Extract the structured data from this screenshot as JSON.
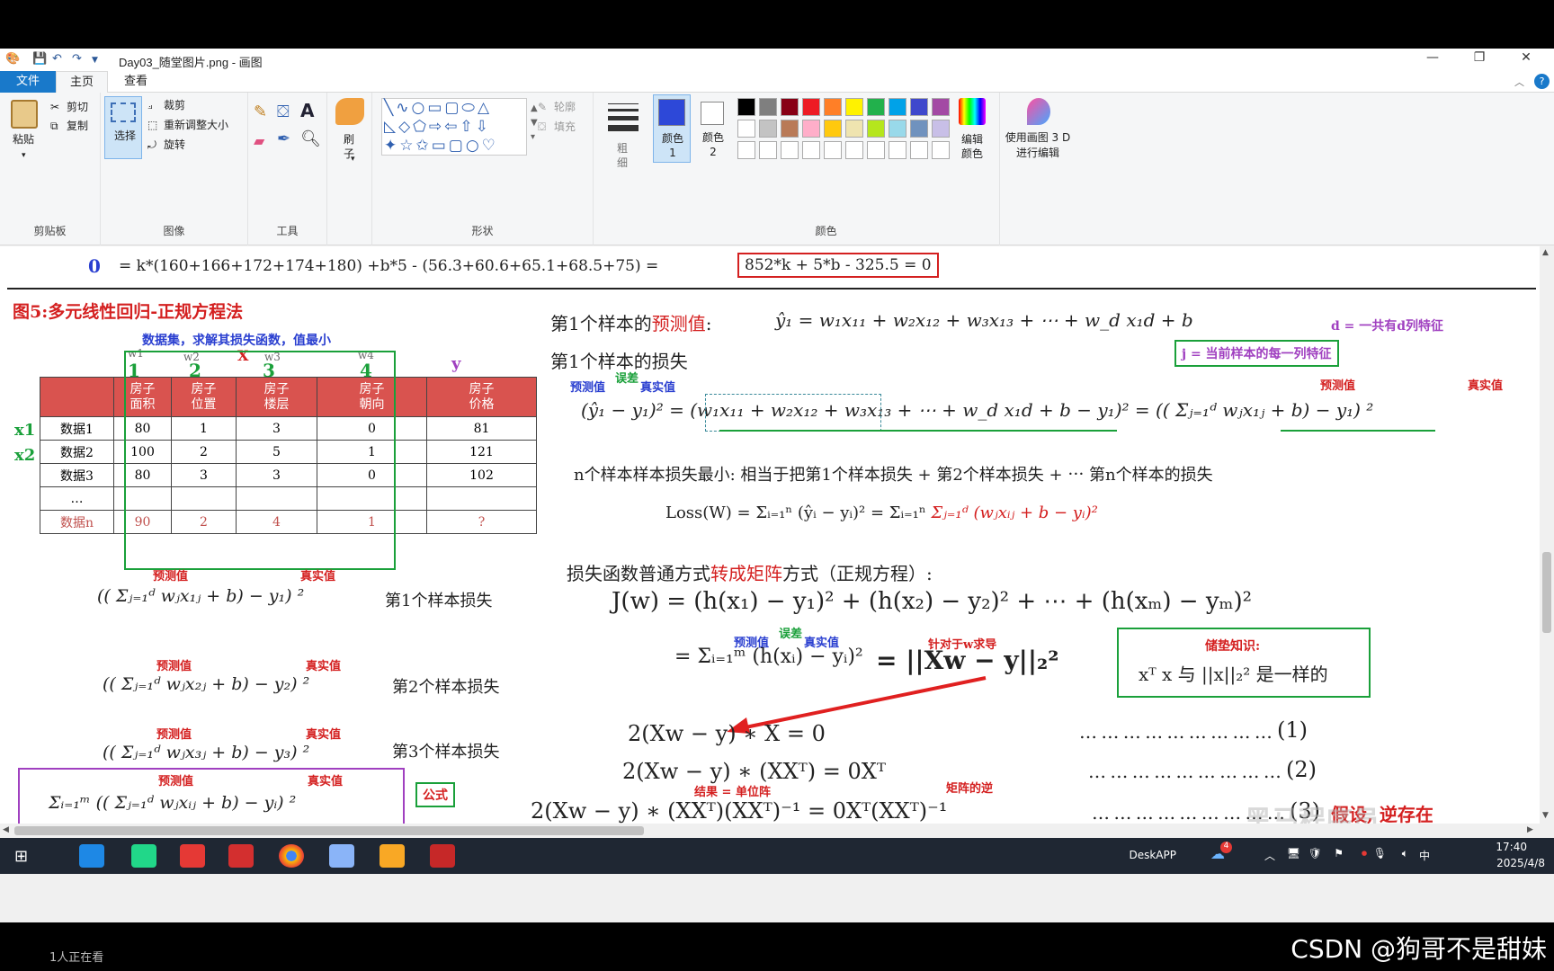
{
  "window": {
    "title": "Day03_随堂图片.png - 画图",
    "minimize": "—",
    "restore": "❐",
    "close": "✕",
    "help": "?"
  },
  "menu": {
    "file": "文件",
    "home": "主页",
    "view": "查看"
  },
  "ribbon": {
    "clipboard": {
      "paste": "粘贴",
      "cut": "剪切",
      "copy": "复制",
      "label": "剪贴板"
    },
    "image": {
      "select": "选择",
      "crop": "裁剪",
      "resize": "重新调整大小",
      "rotate": "旋转",
      "label": "图像"
    },
    "tools": {
      "label": "工具"
    },
    "brush": {
      "label": "刷子"
    },
    "shapes": {
      "outline": "轮廓",
      "fill": "填充",
      "label": "形状"
    },
    "size": {
      "label": "粗细"
    },
    "colors": {
      "color1": "颜色 1",
      "color2": "颜色 2",
      "edit": "编辑颜色",
      "label": "颜色",
      "color1_value": "#2d48d8",
      "color2_value": "#ffffff",
      "palette_row1": [
        "#000000",
        "#7f7f7f",
        "#880015",
        "#ed1c24",
        "#ff7f27",
        "#fff200",
        "#22b14c",
        "#00a2e8",
        "#3f48cc",
        "#a349a4"
      ],
      "palette_row2": [
        "#ffffff",
        "#c3c3c3",
        "#b97a57",
        "#ffaec9",
        "#ffc90e",
        "#efe4b0",
        "#b5e61d",
        "#99d9ea",
        "#7092be",
        "#c8bfe7"
      ]
    },
    "paint3d": {
      "label": "使用画图 3 D 进行编辑"
    }
  },
  "canvas": {
    "top_eq": {
      "zero": "0",
      "lhs": "=  k*(160+166+172+174+180)   +b*5  -  (56.3+60.6+65.1+68.5+75)  =",
      "boxed": "852*k  +   5*b   - 325.5 = 0"
    },
    "fig_title": "图5:多元线性回归-正规方程法",
    "dataset_note": "数据集，求解其损失函数，值最小",
    "weights": [
      "w1",
      "w2",
      "w3",
      "w4"
    ],
    "weight_nums": [
      "1",
      "2",
      "3",
      "4"
    ],
    "cross_mark": "X",
    "y_label": "y",
    "row_labels": [
      "x1",
      "x2"
    ],
    "table": {
      "headers": [
        "房子\n面积",
        "房子\n位置",
        "房子\n楼层",
        "房子\n朝向",
        "房子\n价格"
      ],
      "rows": [
        [
          "数据1",
          "80",
          "1",
          "3",
          "0",
          "81"
        ],
        [
          "数据2",
          "100",
          "2",
          "5",
          "1",
          "121"
        ],
        [
          "数据3",
          "80",
          "3",
          "3",
          "0",
          "102"
        ],
        [
          "…",
          "",
          "",
          "",
          "",
          ""
        ],
        [
          "数据n",
          "90",
          "2",
          "4",
          "1",
          "?"
        ]
      ]
    },
    "pred_label": "预测值",
    "true_label": "真实值",
    "err_label": "误差",
    "left_formulas": [
      {
        "expr": "((  Σⱼ₌₁ᵈ wⱼx₁ⱼ + b)    − y₁) ²",
        "desc": "第1个样本损失"
      },
      {
        "expr": "((  Σⱼ₌₁ᵈ wⱼx₂ⱼ + b)    − y₂) ²",
        "desc": "第2个样本损失"
      },
      {
        "expr": "((  Σⱼ₌₁ᵈ wⱼx₃ⱼ + b)    − y₃) ²",
        "desc": "第3个样本损失"
      }
    ],
    "sum_formula": "Σᵢ₌₁ᵐ  ((  Σⱼ₌₁ᵈ wⱼxᵢⱼ + b)    − yᵢ) ²",
    "formula_tag": "公式",
    "first_pred_title": "第1个样本的",
    "first_pred_red": "预测值",
    "first_pred_colon": ":",
    "first_pred_expr": "ŷ₁  =  w₁x₁₁  +  w₂x₁₂  +  w₃x₁₃  +  ⋯  +  w_d x₁d    + b",
    "d_note": "d = 一共有d列特征",
    "j_note": "j = 当前样本的每一列特征",
    "first_loss_title": "第1个样本的损失",
    "first_loss_expr": "(ŷ₁ − y₁)²  =  (w₁x₁₁ + w₂x₁₂ + w₃x₁₃  +  ⋯  +  w_d x₁d + b − y₁)²  =  ((  Σⱼ₌₁ᵈ wⱼx₁ⱼ + b)    − y₁) ²",
    "n_samples": "n个样本样本损失最小: 相当于把第1个样本损失 + 第2个样本损失 +   ⋯  第n个样本的损失",
    "loss_w": "Loss(W)  =  Σᵢ₌₁ⁿ (ŷᵢ − yᵢ)²  =  Σᵢ₌₁ⁿ",
    "loss_w_red": "Σⱼ₌₁ᵈ (wⱼxᵢⱼ + b − yᵢ)²",
    "matrix_title_a": "损失函数普通方式",
    "matrix_title_red": "转成矩阵",
    "matrix_title_b": "方式（正规方程）:",
    "jw": "J(w) = (h(x₁) − y₁)² + (h(x₂) − y₂)² + ⋯ + (h(xₘ) − yₘ)²",
    "sum_eq": "=  Σᵢ₌₁ᵐ  (h(xᵢ) − yᵢ)²",
    "norm_eq": "=   ||Xw − y||₂²",
    "deriv_note": "针对于w求导",
    "prior_title": "储垫知识:",
    "prior_expr": "xᵀ x  与  ||x||₂²  是一样的",
    "eq1": "2(Xw − y) ∗ X =  0",
    "eq2": "2(Xw − y) ∗ (XXᵀ) =  0Xᵀ",
    "eq3": "2(Xw − y) ∗ (XXᵀ)(XXᵀ)⁻¹  =  0Xᵀ(XXᵀ)⁻¹",
    "eq3_top_note": "结果 = 单位阵",
    "eq3_inv_note": "矩阵的逆",
    "dots": "… … … … … … … … …",
    "eq_nums": [
      "(1)",
      "(2)",
      "(3)"
    ],
    "assume": "假设, 逆存在",
    "watermark": "黑马程序员"
  },
  "taskbar": {
    "deskapp": "DeskAPP",
    "time": "17:40",
    "date": "2025/4/8",
    "ime": "中",
    "badge": "4"
  },
  "overlay": {
    "viewers": "1人正在看",
    "csdn": "CSDN @狗哥不是甜妹"
  }
}
